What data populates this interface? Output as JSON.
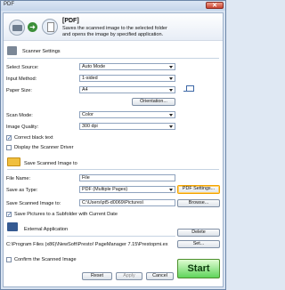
{
  "window": {
    "title": "PDF",
    "close_glyph": "✕"
  },
  "header": {
    "title": "[PDF]",
    "description_line1": "Saves the scanned image to the selected folder",
    "description_line2": "and opens the image by specified application."
  },
  "scanner_settings": {
    "section_title": "Scanner Settings",
    "select_source_label": "Select Source:",
    "select_source_value": "Auto Mode",
    "input_method_label": "Input Method:",
    "input_method_value": "1-sided",
    "paper_size_label": "Paper Size:",
    "paper_size_value": "A4",
    "orientation_button": "Orientation...",
    "scan_mode_label": "Scan Mode:",
    "scan_mode_value": "Color",
    "image_quality_label": "Image Quality:",
    "image_quality_value": "300 dpi",
    "correct_black_text_label": "Correct black text",
    "display_driver_label": "Display the Scanner Driver"
  },
  "save_settings": {
    "section_title": "Save Scanned Image to",
    "file_name_label": "File Name:",
    "file_name_value": "File",
    "save_as_type_label": "Save as Type:",
    "save_as_type_value": "PDF (Multiple Pages)",
    "pdf_settings_button": "PDF Settings...",
    "save_to_label": "Save Scanned Image to:",
    "save_to_value": "C:\\Users\\pt5-d0069\\Pictures\\",
    "browse_button": "Browse...",
    "subfolder_label": "Save Pictures to a Subfolder with Current Date"
  },
  "external_application": {
    "section_title": "External Application",
    "delete_button": "Delete",
    "path_value": "C:\\Program Files (x86)\\NewSoft\\Presto! PageManager 7.15\\Prestopmi.ex",
    "set_button": "Set..."
  },
  "footer": {
    "confirm_label": "Confirm the Scanned Image",
    "reset_button": "Reset",
    "apply_button": "Apply",
    "cancel_button": "Cancel",
    "start_button": "Start"
  },
  "colors": {
    "accent": "#5fd45b",
    "highlight": "#f2a300"
  }
}
